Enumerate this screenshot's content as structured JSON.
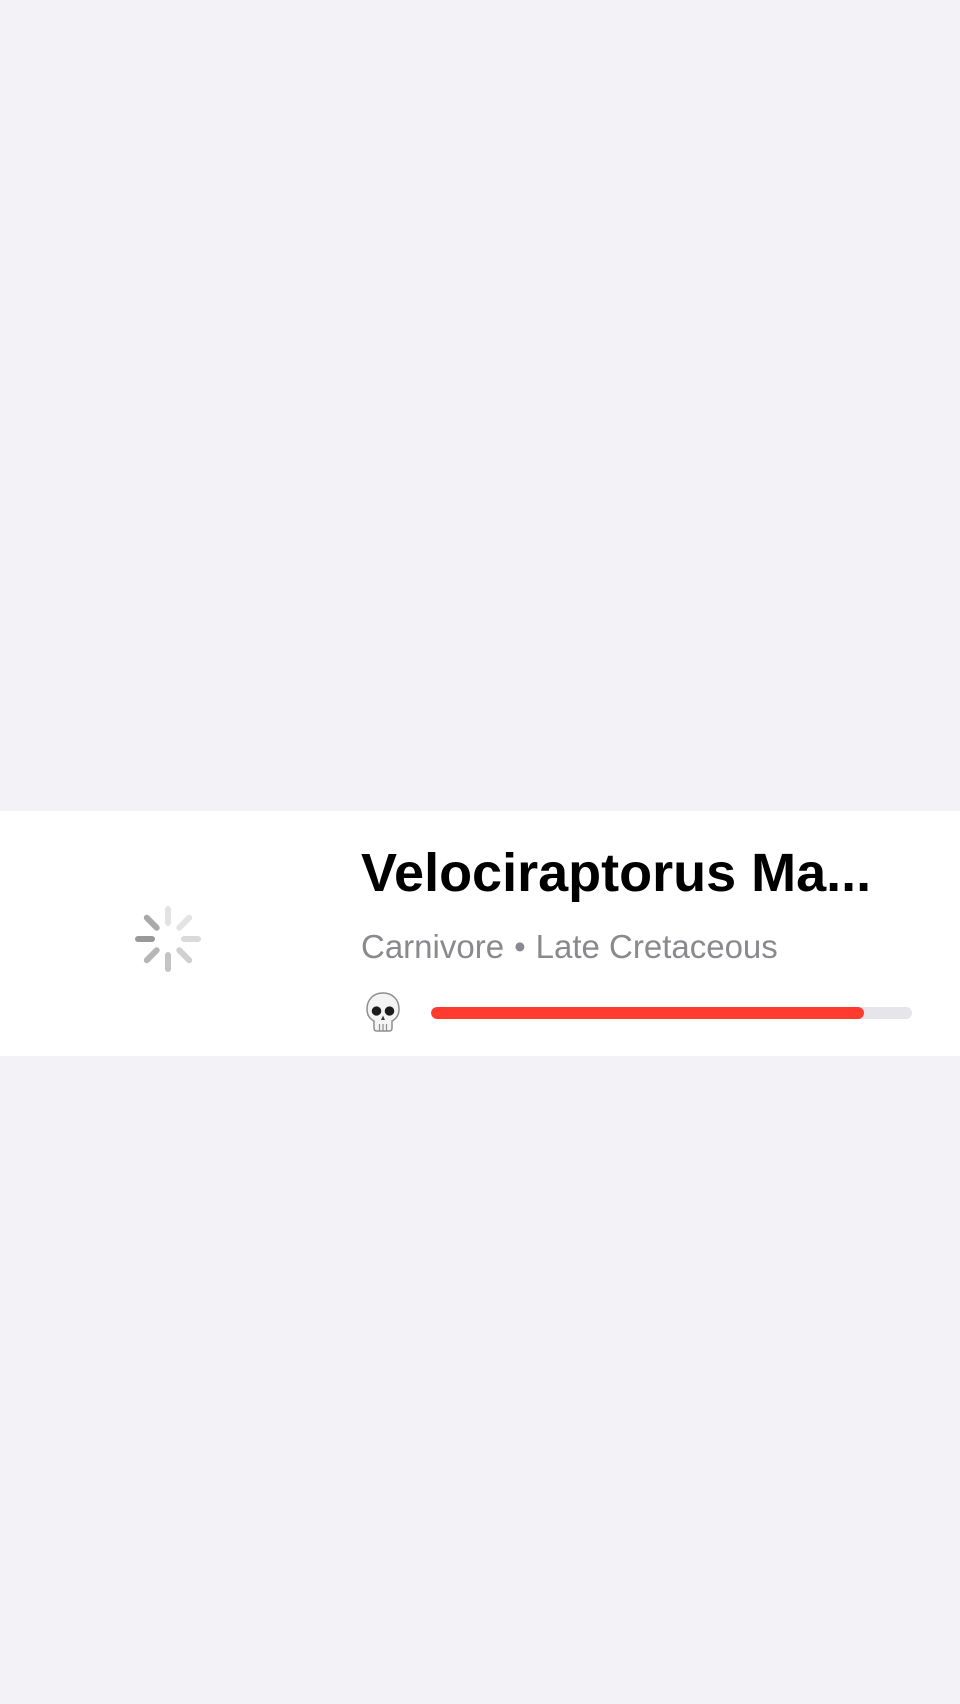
{
  "card": {
    "title": "Velociraptorus Ma...",
    "diet": "Carnivore",
    "separator": "•",
    "period": "Late Cretaceous",
    "loading_icon": "spinner-icon",
    "danger_icon": "skull-icon",
    "danger_level": 0.9
  },
  "colors": {
    "background": "#f2f2f7",
    "card": "#ffffff",
    "danger_bar": "#ff3b30",
    "bar_track": "#e5e5ea",
    "secondary_text": "#8a8a8e"
  }
}
